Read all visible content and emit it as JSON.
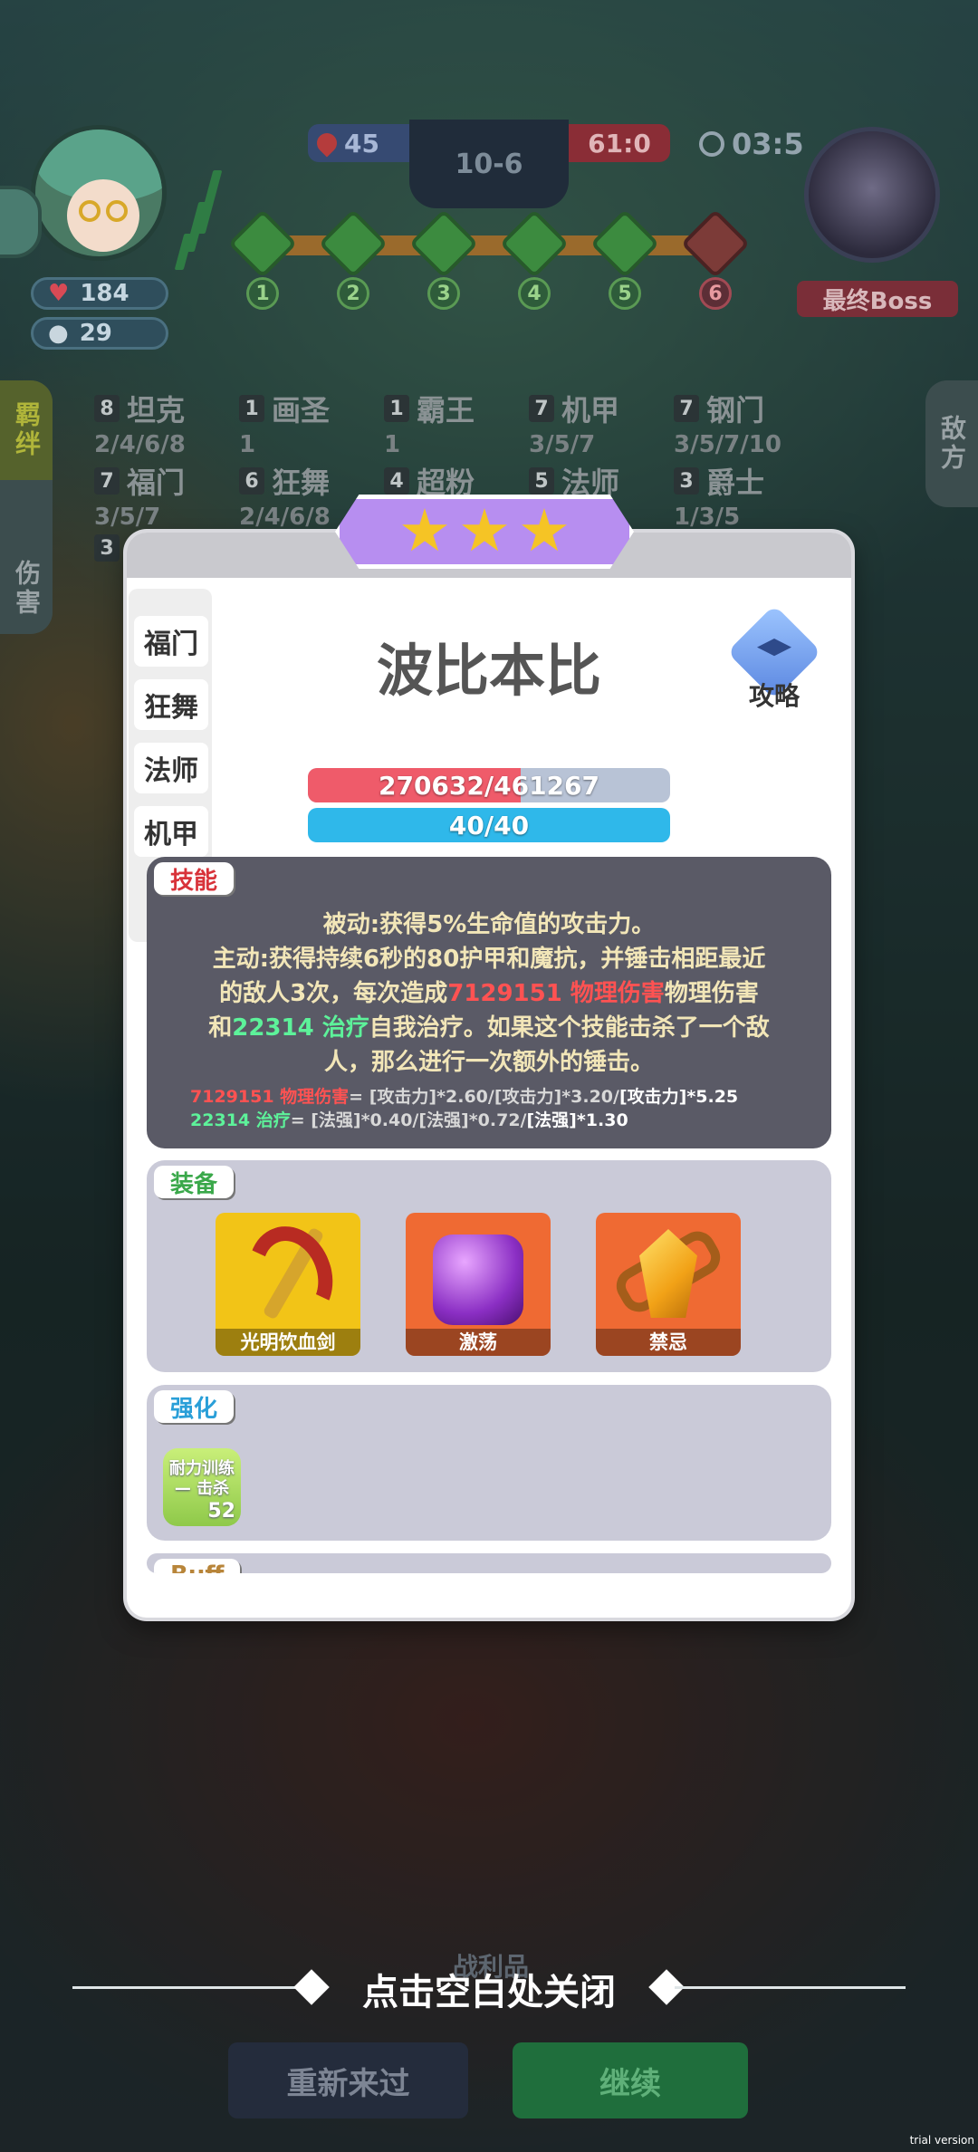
{
  "hud": {
    "hp": "184",
    "coins": "29",
    "fire_count": "45",
    "round": "10-6",
    "score": "61:0",
    "timer": "03:5",
    "boss_label": "最终Boss",
    "stages": [
      "1",
      "2",
      "3",
      "4",
      "5",
      "6"
    ]
  },
  "side_tabs": {
    "left": [
      "羁绊",
      "伤害"
    ],
    "right": "敌方"
  },
  "synergies": [
    {
      "count": "8",
      "name": "坦克",
      "levels": "2/4/6/8"
    },
    {
      "count": "1",
      "name": "画圣",
      "levels": "1"
    },
    {
      "count": "1",
      "name": "霸王",
      "levels": "1"
    },
    {
      "count": "7",
      "name": "机甲",
      "levels": "3/5/7"
    },
    {
      "count": "7",
      "name": "钢门",
      "levels": "3/5/7/10"
    },
    {
      "count": "7",
      "name": "福门",
      "levels": "3/5/7"
    },
    {
      "count": "6",
      "name": "狂舞",
      "levels": "2/4/6/8"
    },
    {
      "count": "4",
      "name": "超粉",
      "levels": ""
    },
    {
      "count": "5",
      "name": "法师",
      "levels": ""
    },
    {
      "count": "3",
      "name": "爵士",
      "levels": "1/3/5"
    },
    {
      "count": "3",
      "name": "",
      "levels": ""
    }
  ],
  "hero": {
    "stars": 3,
    "name": "波比本比",
    "guide_label": "攻略",
    "traits": [
      "福门",
      "狂舞",
      "法师",
      "机甲"
    ],
    "hp_text": "270632/461267",
    "hp_fraction": 0.587,
    "mp_text": "40/40",
    "mp_fraction": 1.0
  },
  "skill": {
    "tag": "技能",
    "line1": "被动:获得5%生命值的攻击力。",
    "line2": "主动:获得持续6秒的80护甲和魔抗，并锤击相距最近",
    "line3a": "的敌人3次，每次造成",
    "line3_dmg": "7129151 物理伤害",
    "line3b": "物理伤害",
    "line4a": "和",
    "line4_heal": "22314 治疗",
    "line4b": "自我治疗。如果这个技能击杀了一个敌",
    "line5": "人，那么进行一次额外的锤击。",
    "formula1_val": "7129151 物理伤害",
    "formula1_text": "= [攻击力]*2.60/[攻击力]*3.20/",
    "formula1_tail": "[攻击力]*5.25",
    "formula2_val": "22314 治疗",
    "formula2_text": "= [法强]*0.40/[法强]*0.72/",
    "formula2_tail": "[法强]*1.30"
  },
  "equipment": {
    "tag": "装备",
    "items": [
      "光明饮血剑",
      "激荡",
      "禁忌"
    ]
  },
  "enhance": {
    "tag": "强化",
    "item_name": "耐力训练 — 击杀",
    "item_value": "52"
  },
  "buff": {
    "tag": "Buff"
  },
  "bottom": {
    "battle_label": "战利品",
    "close_hint": "点击空白处关闭",
    "retry": "重新来过",
    "continue": "继续"
  },
  "watermark": "trial version",
  "colors": {
    "damage": "#ff5252",
    "heal": "#5df29a",
    "hp_bar": "#ef5b6a",
    "mp_bar": "#2fb8ea",
    "star": "#f5c425",
    "ribbon": "#b78ef0"
  }
}
